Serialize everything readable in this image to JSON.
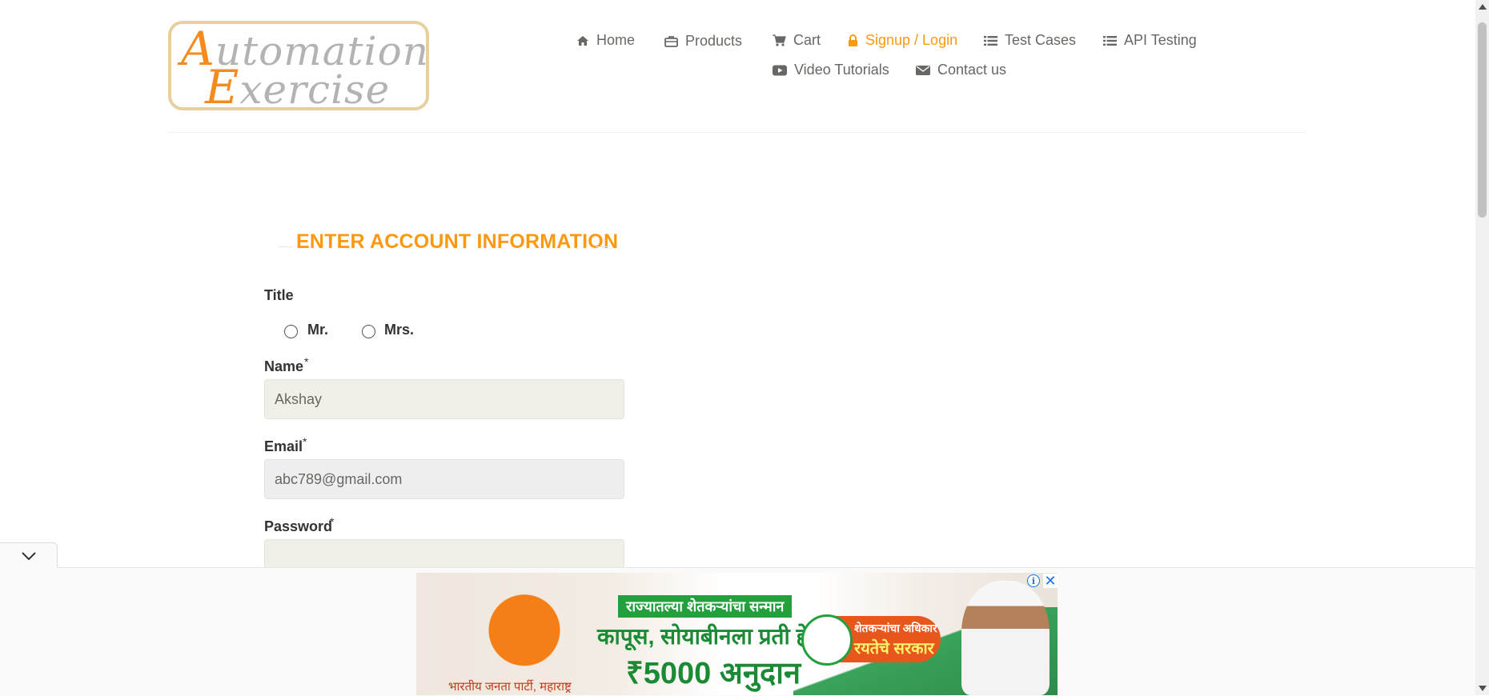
{
  "logo": {
    "line1_cap": "A",
    "line1_rest": "utomation",
    "line2_cap": "E",
    "line2_rest": "xercise"
  },
  "nav": {
    "items": [
      {
        "label": "Home",
        "icon": "home-icon"
      },
      {
        "label": "Products",
        "icon": "briefcase-icon"
      },
      {
        "label": "Cart",
        "icon": "cart-icon"
      },
      {
        "label": "Signup / Login",
        "icon": "lock-icon",
        "active": true
      },
      {
        "label": "Test Cases",
        "icon": "list-icon"
      },
      {
        "label": "API Testing",
        "icon": "list-icon"
      },
      {
        "label": "Video Tutorials",
        "icon": "youtube-play-icon"
      },
      {
        "label": "Contact us",
        "icon": "envelope-icon"
      }
    ]
  },
  "form": {
    "heading": "ENTER ACCOUNT INFORMATION",
    "title_label": "Title",
    "title_options": [
      "Mr.",
      "Mrs."
    ],
    "name_label": "Name",
    "name_value": "Akshay",
    "email_label": "Email",
    "email_value": "abc789@gmail.com",
    "password_label": "Password",
    "password_value": "",
    "required_marker": "*"
  },
  "ad": {
    "headline1": "राज्यातल्या शेतकऱ्यांचा सन्मान",
    "headline2": "कापूस, सोयाबीनला प्रती हेक्टरी",
    "headline3": "₹5000 अनुदान",
    "badge_line1": "शेतकऱ्यांचा अधिकार",
    "badge_line2": "रयतेचे सरकार",
    "footer": "भारतीय जनता पार्टी, महाराष्ट्र",
    "info_glyph": "i",
    "close_glyph": "✕"
  },
  "colors": {
    "accent": "#fe980f",
    "text": "#696763",
    "input_bg": "#f0f0e9"
  }
}
